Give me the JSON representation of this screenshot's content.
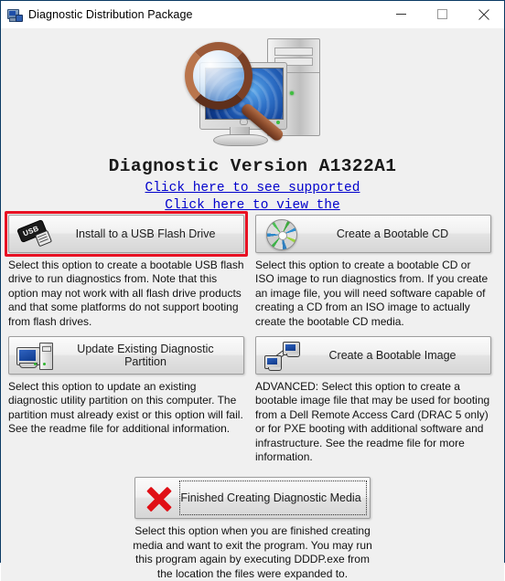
{
  "window": {
    "title": "Diagnostic Distribution Package",
    "icon": "computer-network-icon",
    "controls": {
      "minimize": "minimize-icon",
      "maximize": "maximize-icon",
      "close": "close-icon"
    }
  },
  "hero": {
    "image_alt": "magnifying-glass-over-computer-icon"
  },
  "header": {
    "version_title": "Diagnostic Version A1322A1",
    "links": [
      {
        "text": "Click here to see supported"
      },
      {
        "text": "Click here to view the"
      }
    ],
    "link_color": "#0000cc"
  },
  "options": [
    {
      "id": "usb-flash-drive",
      "label": "Install to a USB Flash Drive",
      "icon": "usb-flash-drive-icon",
      "focused": true,
      "focus_color": "#e81123",
      "description": "Select this option to create a bootable USB flash drive to run diagnostics from. Note that this option may not work with all flash drive  products and that some platforms do not support booting from flash drives."
    },
    {
      "id": "bootable-cd",
      "label": "Create a Bootable CD",
      "icon": "compact-disc-icon",
      "focused": false,
      "description": "Select this option to create a bootable CD or ISO image to run diagnostics from. If you create an image file, you will need software capable of creating a CD from an ISO image to actually create the bootable CD media."
    },
    {
      "id": "update-partition",
      "label": "Update Existing Diagnostic Partition",
      "icon": "desktop-computer-icon",
      "focused": false,
      "description": "Select this option to update an existing diagnostic utility partition on this computer. The partition must already exist or this option will fail. See the readme file for additional information."
    },
    {
      "id": "bootable-image",
      "label": "Create a Bootable Image",
      "icon": "network-computers-icon",
      "focused": false,
      "description": "ADVANCED: Select this option to create a bootable image file that may be used for booting from a Dell Remote Access Card (DRAC 5 only) or for PXE booting with additional software and infrastructure. See the readme file for more information."
    }
  ],
  "finished": {
    "label": "Finished Creating Diagnostic Media",
    "icon": "red-x-icon",
    "icon_color": "#e00f16",
    "description": "Select this option when you are finished creating media and want to exit the program. You may run this program again by executing DDDP.exe from the location the files were expanded to."
  }
}
